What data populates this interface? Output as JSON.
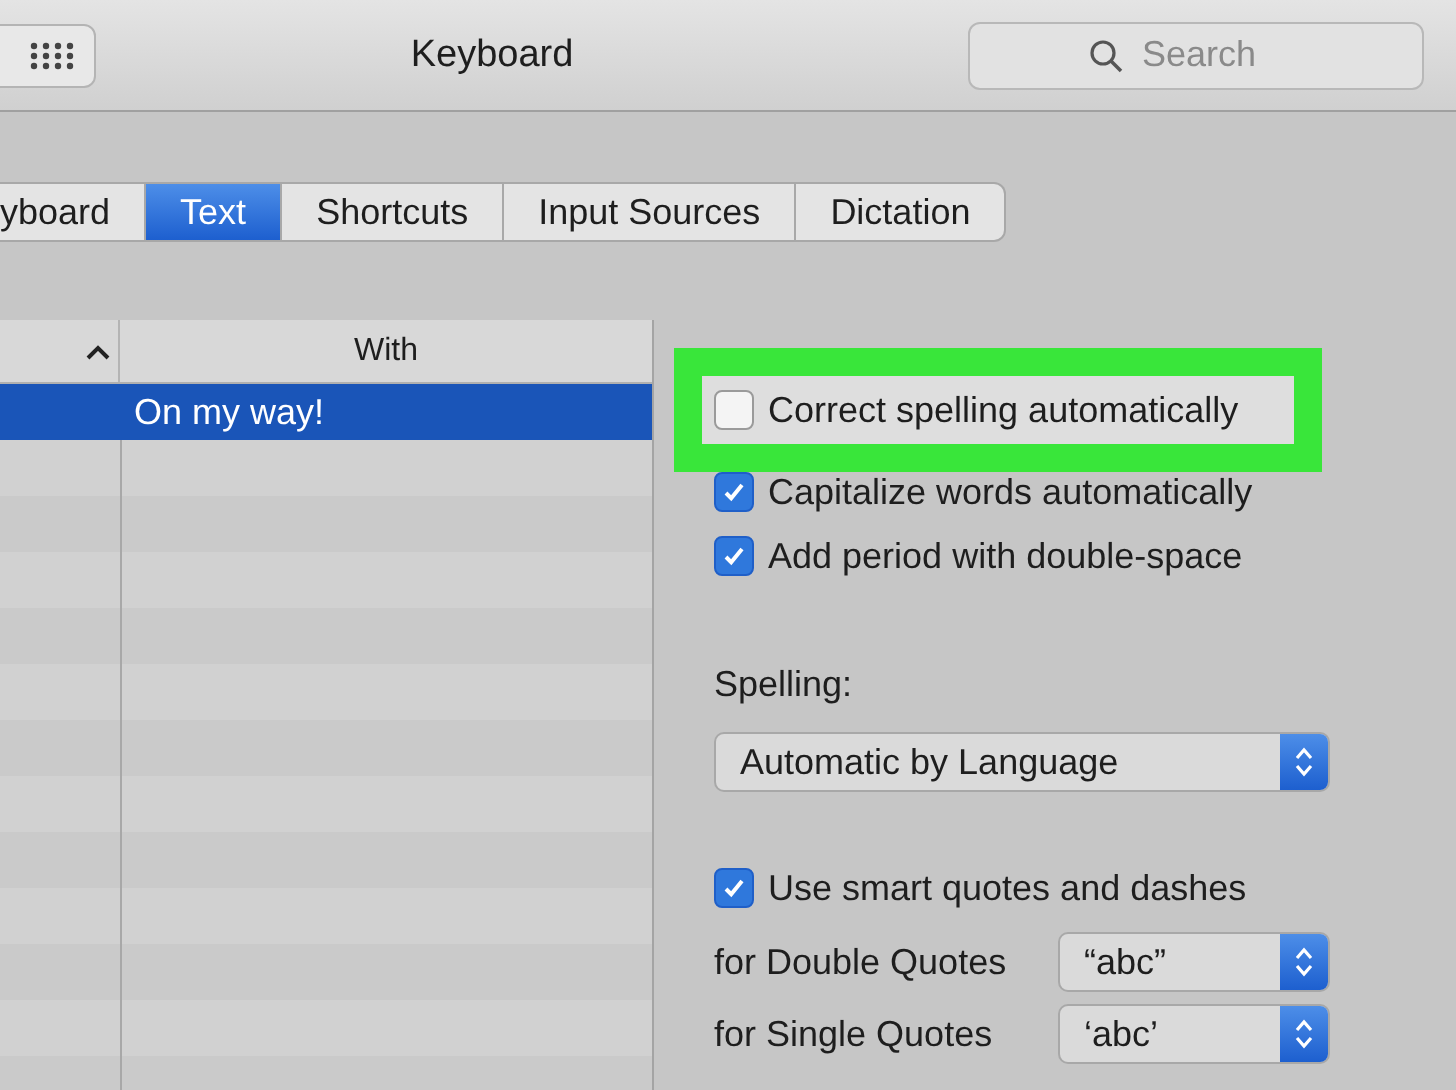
{
  "window": {
    "title": "Keyboard"
  },
  "search": {
    "placeholder": "Search"
  },
  "tabs": [
    {
      "label": "yboard",
      "selected": false
    },
    {
      "label": "Text",
      "selected": true
    },
    {
      "label": "Shortcuts",
      "selected": false
    },
    {
      "label": "Input Sources",
      "selected": false
    },
    {
      "label": "Dictation",
      "selected": false
    }
  ],
  "table": {
    "columns": [
      {
        "sort_ascending": true
      },
      {
        "label": "With"
      }
    ],
    "rows": [
      {
        "with": "On my way!",
        "selected": true
      }
    ]
  },
  "options": [
    {
      "kind": "checkbox",
      "label": "Correct spelling automatically",
      "checked": false,
      "highlighted": true
    },
    {
      "kind": "checkbox",
      "label": "Capitalize words automatically",
      "checked": true,
      "highlighted": false
    },
    {
      "kind": "checkbox",
      "label": "Add period with double-space",
      "checked": true,
      "highlighted": false
    },
    {
      "kind": "heading",
      "label": "Spelling:"
    },
    {
      "kind": "select",
      "value": "Automatic by Language"
    },
    {
      "kind": "checkbox",
      "label": "Use smart quotes and dashes",
      "checked": true,
      "highlighted": false
    },
    {
      "kind": "labeled_select",
      "label": "for Double Quotes",
      "value": "“abc”"
    },
    {
      "kind": "labeled_select",
      "label": "for Single Quotes",
      "value": "‘abc’"
    }
  ]
}
